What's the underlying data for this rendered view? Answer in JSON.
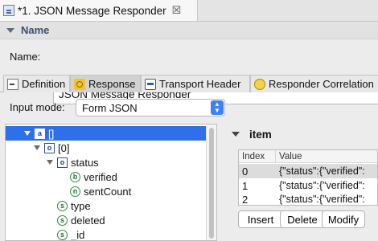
{
  "editor_tab": {
    "title": "*1. JSON Message Responder",
    "close_glyph": "☒",
    "icon": "editor-icon"
  },
  "name_section": {
    "title": "Name",
    "label": "Name:",
    "value": "JSON Message Responder"
  },
  "tabs": [
    {
      "label": "Definition",
      "icon": "definition-icon",
      "active": false
    },
    {
      "label": "Response",
      "icon": "response-icon",
      "active": true
    },
    {
      "label": "Transport Header",
      "icon": "transport-icon",
      "active": false
    },
    {
      "label": "Responder Correlation",
      "icon": "correlation-icon",
      "active": false
    }
  ],
  "input_mode": {
    "label": "Input mode:",
    "value": "Form JSON"
  },
  "tree": {
    "nodes": [
      {
        "badge": "a",
        "label": "[]",
        "kind": "array",
        "expanded": true,
        "selected": true
      },
      {
        "badge": "o",
        "label": "[0]",
        "kind": "object",
        "expanded": true
      },
      {
        "badge": "o",
        "label": "status",
        "kind": "object",
        "expanded": true
      },
      {
        "badge": "b",
        "label": "verified",
        "kind": "boolean"
      },
      {
        "badge": "n",
        "label": "sentCount",
        "kind": "number"
      },
      {
        "badge": "s",
        "label": "type",
        "kind": "string"
      },
      {
        "badge": "s",
        "label": "deleted",
        "kind": "string"
      },
      {
        "badge": "s",
        "label": "_id",
        "kind": "string"
      }
    ]
  },
  "item_panel": {
    "title": "item",
    "columns": [
      "Index",
      "Value"
    ],
    "rows": [
      {
        "index": "0",
        "value": "{\"status\":{\"verified\":"
      },
      {
        "index": "1",
        "value": "{\"status\":{\"verified\":"
      },
      {
        "index": "2",
        "value": "{\"status\":{\"verified\":"
      }
    ],
    "buttons": {
      "insert": "Insert",
      "delete": "Delete",
      "modify": "Modify"
    }
  },
  "colors": {
    "selection": "#2f6fe8",
    "section_title": "#3a4e75",
    "select_accent": "#3b82f6"
  }
}
